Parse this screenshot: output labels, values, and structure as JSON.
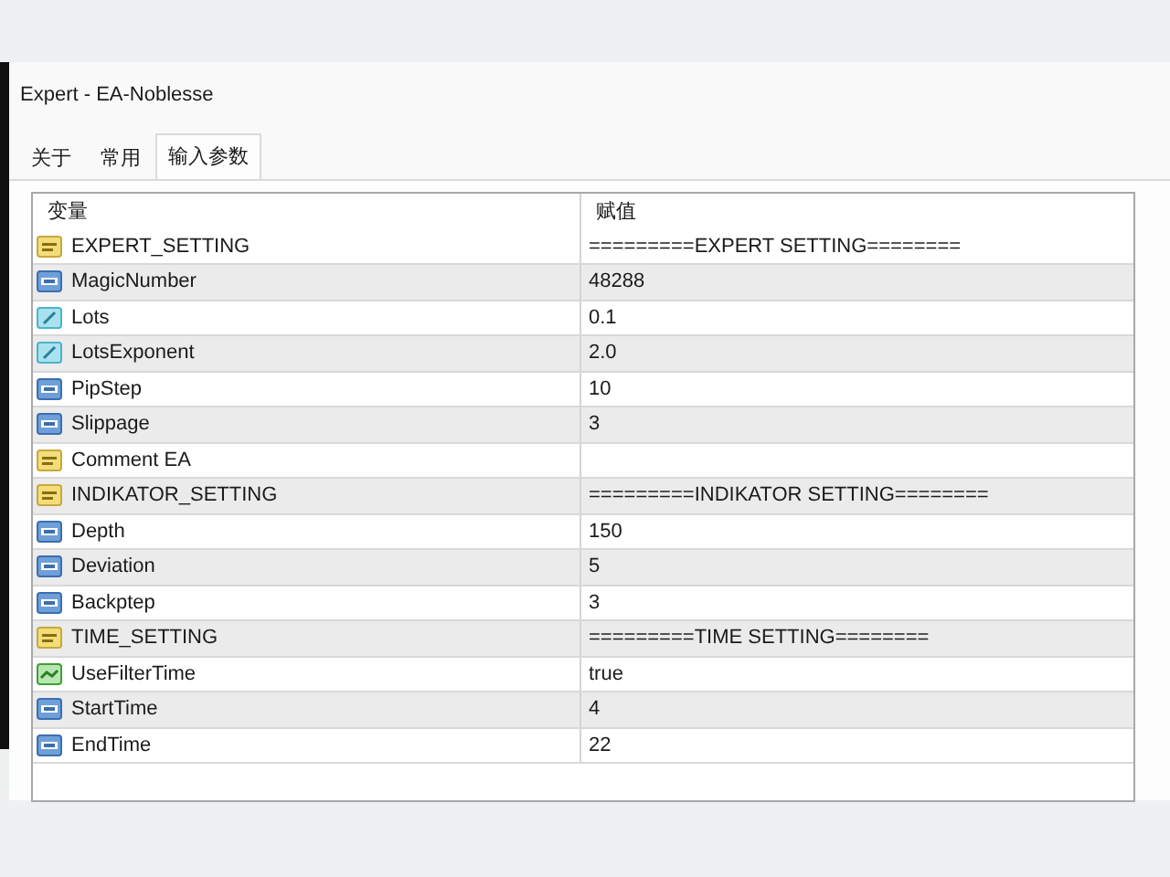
{
  "window": {
    "title": "Expert - EA-Noblesse"
  },
  "tabs": [
    {
      "label": "关于",
      "selected": false
    },
    {
      "label": "常用",
      "selected": false
    },
    {
      "label": "输入参数",
      "selected": true
    }
  ],
  "table": {
    "columns": [
      "变量",
      "赋值"
    ],
    "rows": [
      {
        "kind": "string",
        "name": "EXPERT_SETTING",
        "value": "=========EXPERT SETTING========"
      },
      {
        "kind": "int",
        "name": "MagicNumber",
        "value": "48288"
      },
      {
        "kind": "double",
        "name": "Lots",
        "value": "0.1"
      },
      {
        "kind": "double",
        "name": "LotsExponent",
        "value": "2.0"
      },
      {
        "kind": "int",
        "name": "PipStep",
        "value": "10"
      },
      {
        "kind": "int",
        "name": "Slippage",
        "value": "3"
      },
      {
        "kind": "string",
        "name": "Comment EA"
      },
      {
        "kind": "string",
        "name": "INDIKATOR_SETTING",
        "value": "=========INDIKATOR SETTING========"
      },
      {
        "kind": "int",
        "name": "Depth",
        "value": "150"
      },
      {
        "kind": "int",
        "name": "Deviation",
        "value": "5"
      },
      {
        "kind": "int",
        "name": "Backptep",
        "value": "3"
      },
      {
        "kind": "string",
        "name": "TIME_SETTING",
        "value": "=========TIME SETTING========"
      },
      {
        "kind": "bool",
        "name": "UseFilterTime",
        "value": "true"
      },
      {
        "kind": "int",
        "name": "StartTime",
        "value": "4"
      },
      {
        "kind": "int",
        "name": "EndTime",
        "value": "22"
      }
    ]
  }
}
